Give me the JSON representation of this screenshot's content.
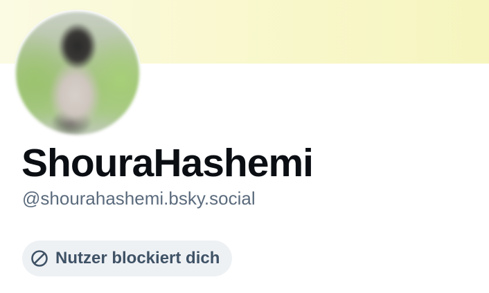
{
  "profile": {
    "display_name": "ShouraHashemi",
    "handle": "@shourahashemi.bsky.social",
    "avatar_icon": "blurred-profile-photo",
    "banner_color": "#f8f7cb"
  },
  "block_status": {
    "label": "Nutzer blockiert dich",
    "icon": "block-icon",
    "text_color": "#3f5266",
    "background": "#eef1f4"
  }
}
